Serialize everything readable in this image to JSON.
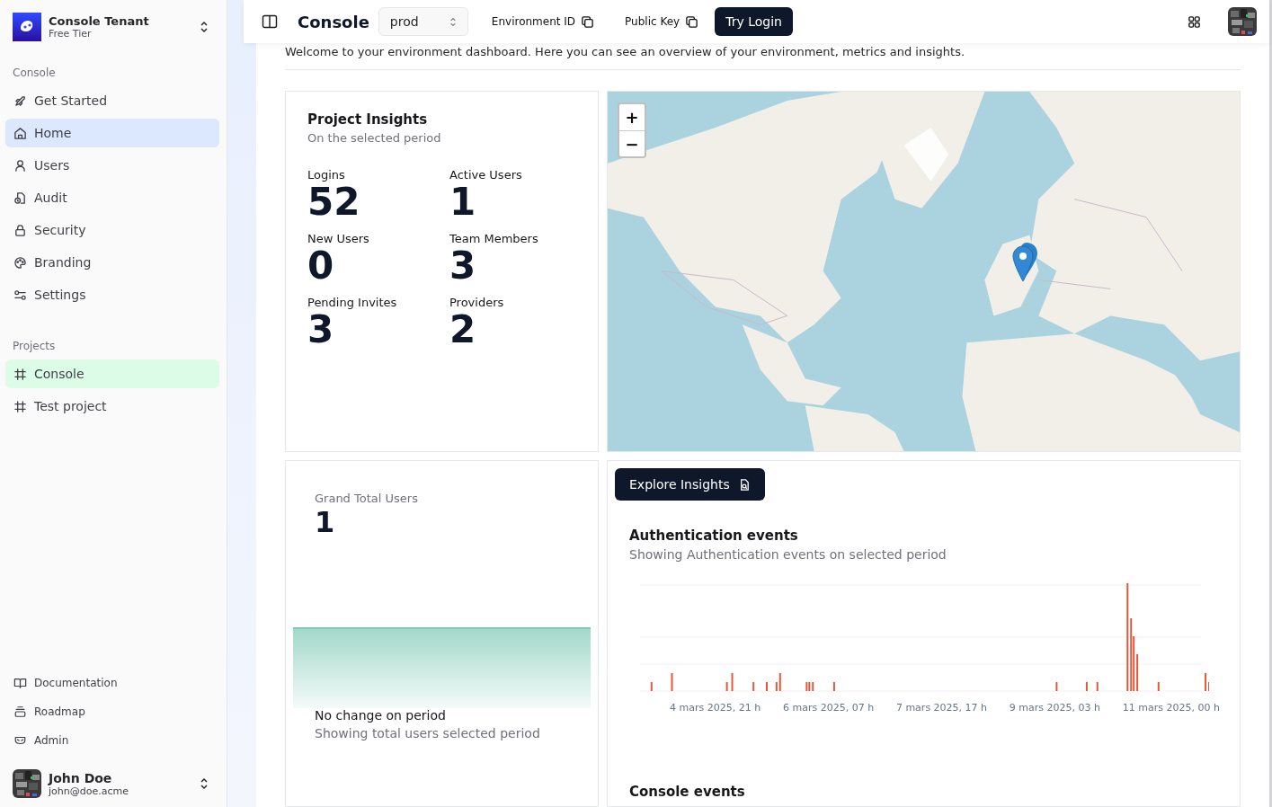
{
  "sidebar": {
    "tenant": {
      "name": "Console Tenant",
      "plan": "Free Tier"
    },
    "sections": [
      {
        "heading": "Console",
        "items": [
          {
            "label": "Get Started",
            "kind": "rocket",
            "selected": false
          },
          {
            "label": "Home",
            "kind": "home",
            "selected": true
          },
          {
            "label": "Users",
            "kind": "user",
            "selected": false
          },
          {
            "label": "Audit",
            "kind": "audit",
            "selected": false
          },
          {
            "label": "Security",
            "kind": "lock",
            "selected": false
          },
          {
            "label": "Branding",
            "kind": "palette",
            "selected": false
          },
          {
            "label": "Settings",
            "kind": "sliders",
            "selected": false
          }
        ]
      },
      {
        "heading": "Projects",
        "items": [
          {
            "label": "Console",
            "kind": "hash",
            "selected": true
          },
          {
            "label": "Test project",
            "kind": "hash",
            "selected": false
          }
        ]
      }
    ],
    "footer_links": [
      {
        "label": "Documentation",
        "kind": "book"
      },
      {
        "label": "Roadmap",
        "kind": "stack"
      },
      {
        "label": "Admin",
        "kind": "mask"
      }
    ],
    "user": {
      "name": "John Doe",
      "email": "john@doe.acme"
    }
  },
  "header": {
    "title": "Console",
    "environment": "prod",
    "env_id_label": "Environment ID",
    "public_key_label": "Public Key",
    "try_login": "Try Login"
  },
  "welcome": "Welcome to your environment dashboard. Here you can see an overview of your environment, metrics and insights.",
  "project_insights": {
    "title": "Project Insights",
    "subtitle": "On the selected period",
    "stats": [
      {
        "label": "Logins",
        "value": "52"
      },
      {
        "label": "Active Users",
        "value": "1"
      },
      {
        "label": "New Users",
        "value": "0"
      },
      {
        "label": "Team Members",
        "value": "3"
      },
      {
        "label": "Pending Invites",
        "value": "3"
      },
      {
        "label": "Providers",
        "value": "2"
      }
    ]
  },
  "map": {
    "zoom_in": "+",
    "zoom_out": "−"
  },
  "grand_total": {
    "label": "Grand Total Users",
    "value": "1",
    "change": "No change on period",
    "caption": "Showing total users selected period"
  },
  "explore_button": "Explore Insights",
  "auth_events": {
    "title": "Authentication events",
    "subtitle": "Showing Authentication events on selected period",
    "x_labels": [
      "4 mars 2025, 21 h",
      "6 mars 2025, 07 h",
      "7 mars 2025, 17 h",
      "9 mars 2025, 03 h",
      "11 mars 2025, 00 h"
    ]
  },
  "console_events": {
    "title": "Console events"
  }
}
